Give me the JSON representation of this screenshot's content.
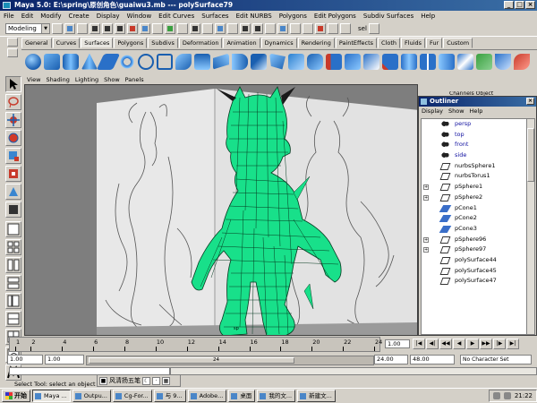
{
  "window": {
    "title": "Maya 5.0: E:\\spring\\原创角色\\guaiwu3.mb  ---  polySurface79"
  },
  "menubar": [
    "File",
    "Edit",
    "Modify",
    "Create",
    "Display",
    "Window",
    "Edit Curves",
    "Surfaces",
    "Edit NURBS",
    "Polygons",
    "Edit Polygons",
    "Subdiv Surfaces",
    "Help"
  ],
  "statusline": {
    "mode": "Modeling",
    "sel_label": "sel"
  },
  "shelf_tabs": [
    "General",
    "Curves",
    "Surfaces",
    "Polygons",
    "Subdivs",
    "Deformation",
    "Animation",
    "Dynamics",
    "Rendering",
    "PaintEffects",
    "Cloth",
    "Fluids",
    "Fur",
    "Custom"
  ],
  "shelf_active_tab": "Surfaces",
  "viewport_menu": [
    "View",
    "Shading",
    "Lighting",
    "Show",
    "Panels"
  ],
  "viewport": {
    "axis_label": "sp"
  },
  "channels_tab": "Channels  Object",
  "outliner": {
    "title": "Outliner",
    "menu": [
      "Display",
      "Show",
      "Help"
    ],
    "items": [
      {
        "name": "persp",
        "icon": "camera",
        "expand": false
      },
      {
        "name": "top",
        "icon": "camera",
        "expand": false
      },
      {
        "name": "front",
        "icon": "camera",
        "expand": false
      },
      {
        "name": "side",
        "icon": "camera",
        "expand": false
      },
      {
        "name": "nurbsSphere1",
        "icon": "shape",
        "expand": false
      },
      {
        "name": "nurbsTorus1",
        "icon": "shape",
        "expand": false
      },
      {
        "name": "pSphere1",
        "icon": "shape",
        "expand": true
      },
      {
        "name": "pSphere2",
        "icon": "shape",
        "expand": true
      },
      {
        "name": "pCone1",
        "icon": "plane",
        "expand": false
      },
      {
        "name": "pCone2",
        "icon": "plane",
        "expand": false
      },
      {
        "name": "pCone3",
        "icon": "plane",
        "expand": false
      },
      {
        "name": "pSphere96",
        "icon": "shape",
        "expand": true
      },
      {
        "name": "pSphere97",
        "icon": "shape",
        "expand": true
      },
      {
        "name": "polySurface44",
        "icon": "shape",
        "expand": false
      },
      {
        "name": "polySurface45",
        "icon": "shape",
        "expand": false
      },
      {
        "name": "polySurface47",
        "icon": "shape",
        "expand": false
      }
    ]
  },
  "timeline": {
    "ticks": [
      "1",
      "2",
      "4",
      "6",
      "8",
      "10",
      "12",
      "14",
      "16",
      "18",
      "20",
      "22",
      "24"
    ],
    "current_frame": "1.00"
  },
  "range": {
    "start": "1.00",
    "start_inner": "1.00",
    "end_inner": "24.00",
    "end": "48.00",
    "thumb_label": "24",
    "character_set": "No Character Set"
  },
  "helpline": "Select Tool: select an object",
  "ime": {
    "label": "风清扬五笔"
  },
  "taskbar": {
    "start": "开始",
    "tasks": [
      "Maya ...",
      "Outpu...",
      "Cg-For...",
      "与 9...",
      "Adobe...",
      "桌面",
      "我的文...",
      "新建文..."
    ],
    "time": "21:22"
  },
  "colors": {
    "mesh": "#18e08a",
    "mesh_wire": "#063a20",
    "viewport_bg": "#7e7e7e",
    "title_bar": "#0a246a",
    "camera_text": "#1010a0"
  }
}
